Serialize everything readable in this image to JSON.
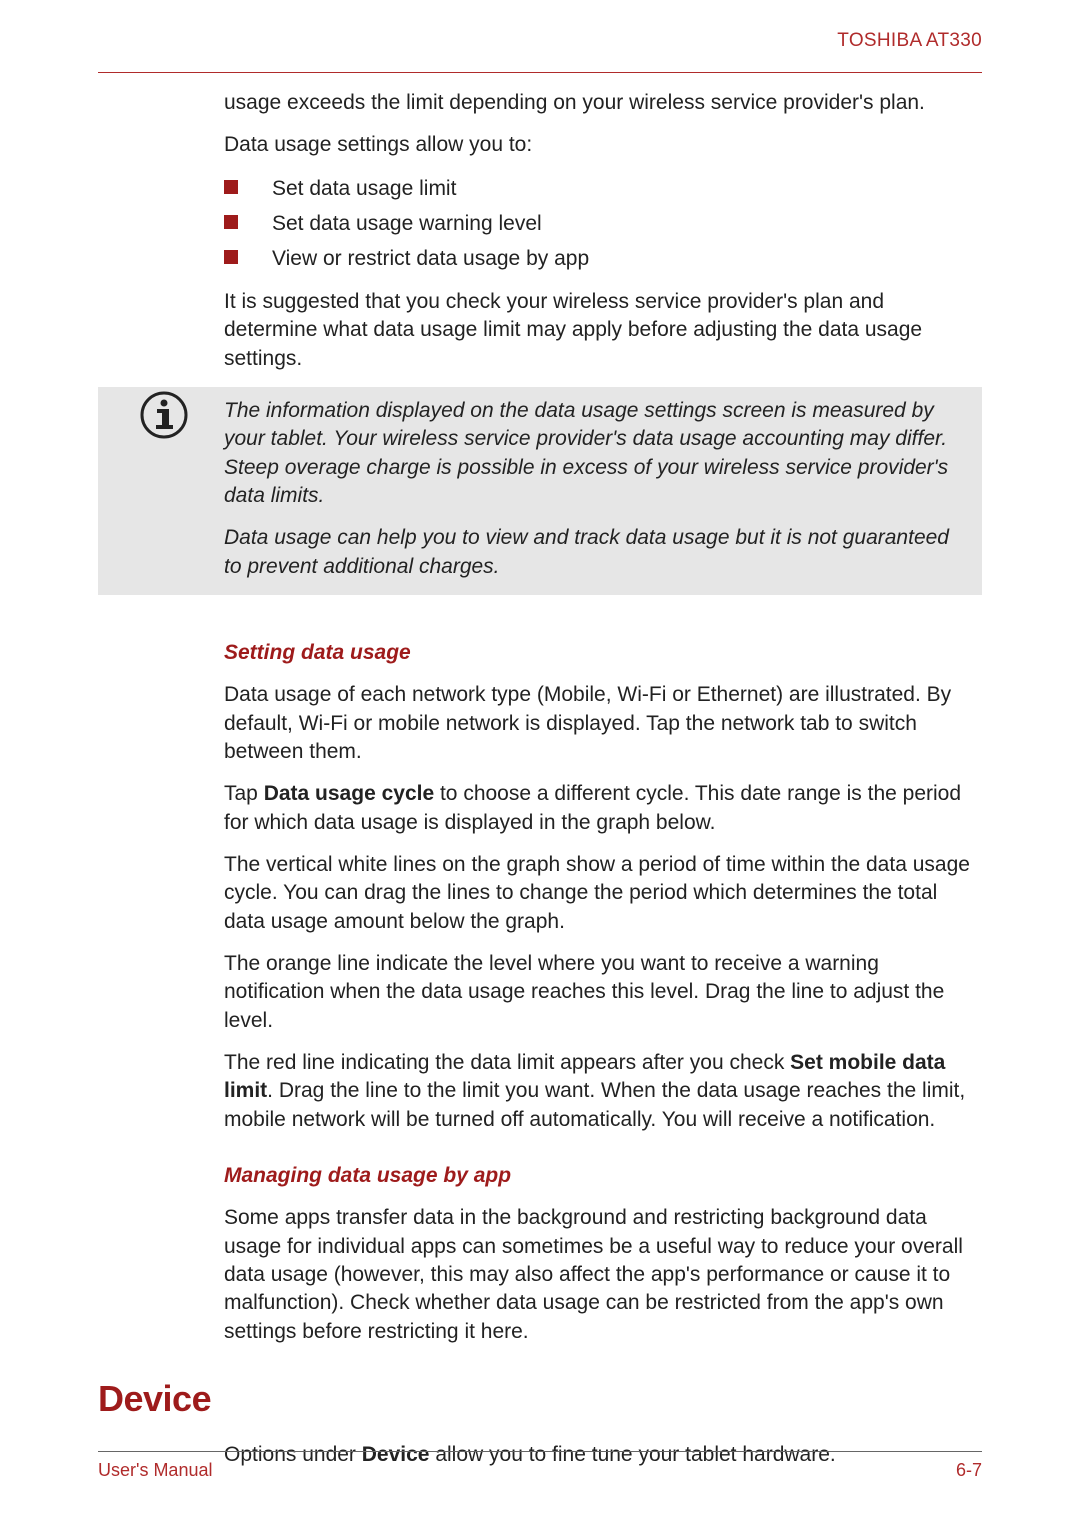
{
  "header": {
    "product": "TOSHIBA AT330"
  },
  "intro": {
    "p1": "usage exceeds the limit depending on your wireless service provider's plan.",
    "p2": "Data usage settings allow you to:",
    "bullets": [
      "Set data usage limit",
      "Set data usage warning level",
      "View or restrict data usage by app"
    ],
    "p3": "It is suggested that you check your wireless service provider's plan and determine what data usage limit may apply before adjusting the data usage settings."
  },
  "note": {
    "p1": "The information displayed on the data usage settings screen is measured by your tablet. Your wireless service provider's data usage accounting may differ. Steep overage charge is possible in excess of your wireless service provider's data limits.",
    "p2": "Data usage can help you to view and track data usage but it is not guaranteed to prevent additional charges."
  },
  "setting": {
    "heading": "Setting data usage",
    "p1": "Data usage of each network type (Mobile, Wi-Fi or Ethernet) are illustrated. By default, Wi-Fi or mobile network is displayed. Tap the network tab to switch between them.",
    "p2_pre": "Tap ",
    "p2_bold": "Data usage cycle",
    "p2_post": " to choose a different cycle. This date range is the period for which data usage is displayed in the graph below.",
    "p3": "The vertical white lines on the graph show a period of time within the data usage cycle. You can drag the lines to change the period which determines the total data usage amount below the graph.",
    "p4": "The orange line indicate the level where you want to receive a warning notification when the data usage reaches this level. Drag the line to adjust the level.",
    "p5_pre": "The red line indicating the data limit appears after you check ",
    "p5_bold": "Set mobile data limit",
    "p5_post": ". Drag the line to the limit you want. When the data usage reaches the limit, mobile network will be turned off automatically. You will receive a notification."
  },
  "managing": {
    "heading": "Managing data usage by app",
    "p1": "Some apps transfer data in the background and restricting background data usage for individual apps can sometimes be a useful way to reduce your overall data usage (however, this may also affect the app's performance or cause it to malfunction). Check whether data usage can be restricted from the app's own settings before restricting it here."
  },
  "device": {
    "heading": "Device",
    "p1_pre": "Options under ",
    "p1_bold": "Device",
    "p1_post": " allow you to fine tune your tablet hardware."
  },
  "footer": {
    "left": "User's Manual",
    "right": "6-7"
  }
}
